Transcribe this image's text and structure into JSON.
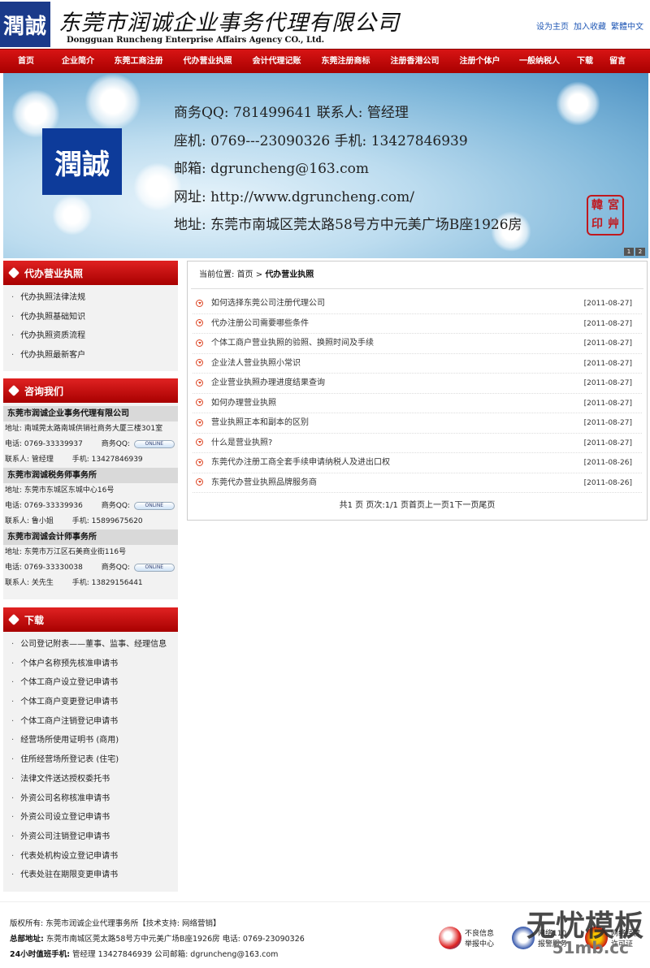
{
  "header": {
    "logo_text": "潤誠",
    "company_cn": "东莞市润诚企业事务代理有限公司",
    "company_en": "Dongguan Runcheng Enterprise Affairs Agency CO., Ltd.",
    "links": [
      "设为主页",
      "加入收藏",
      "繁體中文"
    ]
  },
  "nav": [
    "首页",
    "企业简介",
    "东莞工商注册",
    "代办营业执照",
    "会计代理记账",
    "东莞注册商标",
    "注册香港公司",
    "注册个体户",
    "一般纳税人",
    "下载",
    "留言"
  ],
  "banner": {
    "logo_text": "潤誠",
    "lines": [
      "商务QQ: 781499641      联系人: 管经理",
      "座机: 0769---23090326 手机: 13427846939",
      "邮箱: dgruncheng@163.com",
      "网址: http://www.dgruncheng.com/",
      "地址: 东莞市南城区莞太路58号方中元美广场B座1926房"
    ],
    "seal_text": "韓宮印艸",
    "pager": [
      "1",
      "2"
    ]
  },
  "sidebar": {
    "section1_title": "代办营业执照",
    "section1_items": [
      "代办执照法律法规",
      "代办执照基础知识",
      "代办执照资质流程",
      "代办执照最新客户"
    ],
    "contact_title": "咨询我们",
    "contacts": [
      {
        "company": "东莞市润诚企业事务代理有限公司",
        "address": "地址: 南城莞太路南城供销社商务大厦三楼301室",
        "phone": "电话: 0769-33339937",
        "qq_label": "商务QQ:",
        "contact": "联系人: 管经理",
        "mobile": "手机: 13427846939"
      },
      {
        "company": "东莞市润诚税务师事务所",
        "address": "地址: 东莞市东城区东城中心16号",
        "phone": "电话: 0769-33339936",
        "qq_label": "商务QQ:",
        "contact": "联系人: 鲁小姐",
        "mobile": "手机: 15899675620"
      },
      {
        "company": "东莞市润诚会计师事务所",
        "address": "地址: 东莞市万江区石美商业街116号",
        "phone": "电话: 0769-33330038",
        "qq_label": "商务QQ:",
        "contact": "联系人: 关先生",
        "mobile": "手机: 13829156441"
      }
    ],
    "qq_badge": "ONLINE",
    "download_title": "下载",
    "download_items": [
      "公司登记附表——董事、监事、经理信息",
      "个体户名称预先核准申请书",
      "个体工商户设立登记申请书",
      "个体工商户变更登记申请书",
      "个体工商户注销登记申请书",
      "经营场所使用证明书 (商用)",
      "住所经营场所登记表 (住宅)",
      "法律文件送达授权委托书",
      "外资公司名称核准申请书",
      "外资公司设立登记申请书",
      "外资公司注销登记申请书",
      "代表处机构设立登记申请书",
      "代表处驻在期限变更申请书"
    ]
  },
  "main": {
    "crumb_prefix": "当前位置: ",
    "crumb_home": "首页",
    "crumb_sep": " > ",
    "crumb_current": "代办营业执照",
    "news": [
      {
        "title": "如何选择东莞公司注册代理公司",
        "date": "[2011-08-27]"
      },
      {
        "title": "代办注册公司需要哪些条件",
        "date": "[2011-08-27]"
      },
      {
        "title": "个体工商户营业执照的验照、换照时间及手续",
        "date": "[2011-08-27]"
      },
      {
        "title": "企业法人营业执照小常识",
        "date": "[2011-08-27]"
      },
      {
        "title": "企业营业执照办理进度结果查询",
        "date": "[2011-08-27]"
      },
      {
        "title": "如何办理营业执照",
        "date": "[2011-08-27]"
      },
      {
        "title": "营业执照正本和副本的区别",
        "date": "[2011-08-27]"
      },
      {
        "title": "什么是营业执照?",
        "date": "[2011-08-27]"
      },
      {
        "title": "东莞代办注册工商全套手续申请纳税人及进出口权",
        "date": "[2011-08-26]"
      },
      {
        "title": "东莞代办营业执照品牌服务商",
        "date": "[2011-08-26]"
      }
    ],
    "paging": "共1 页 页次:1/1 页首页上一页1下一页尾页"
  },
  "footer": {
    "line1": "版权所有: 东莞市润诚企业代理事务所【技术支持: 网络营销】",
    "line2_label": "总部地址:",
    "line2": " 东莞市南城区莞太路58号方中元美广场B座1926房 电话: 0769-23090326",
    "line3_label": "24小时值班手机:",
    "line3": " 管经理 13427846939 公司邮箱: dgruncheng@163.com",
    "badges": [
      "不良信息 举报中心",
      "网络110 报警服务",
      "网络经营 许可证"
    ],
    "watermark": "无忧模板",
    "watermark_sub": "51mb.cc"
  },
  "colors": {
    "nav_red": "#c00000",
    "link_blue": "#1f57b5",
    "logo_blue": "#1a3a8a"
  }
}
